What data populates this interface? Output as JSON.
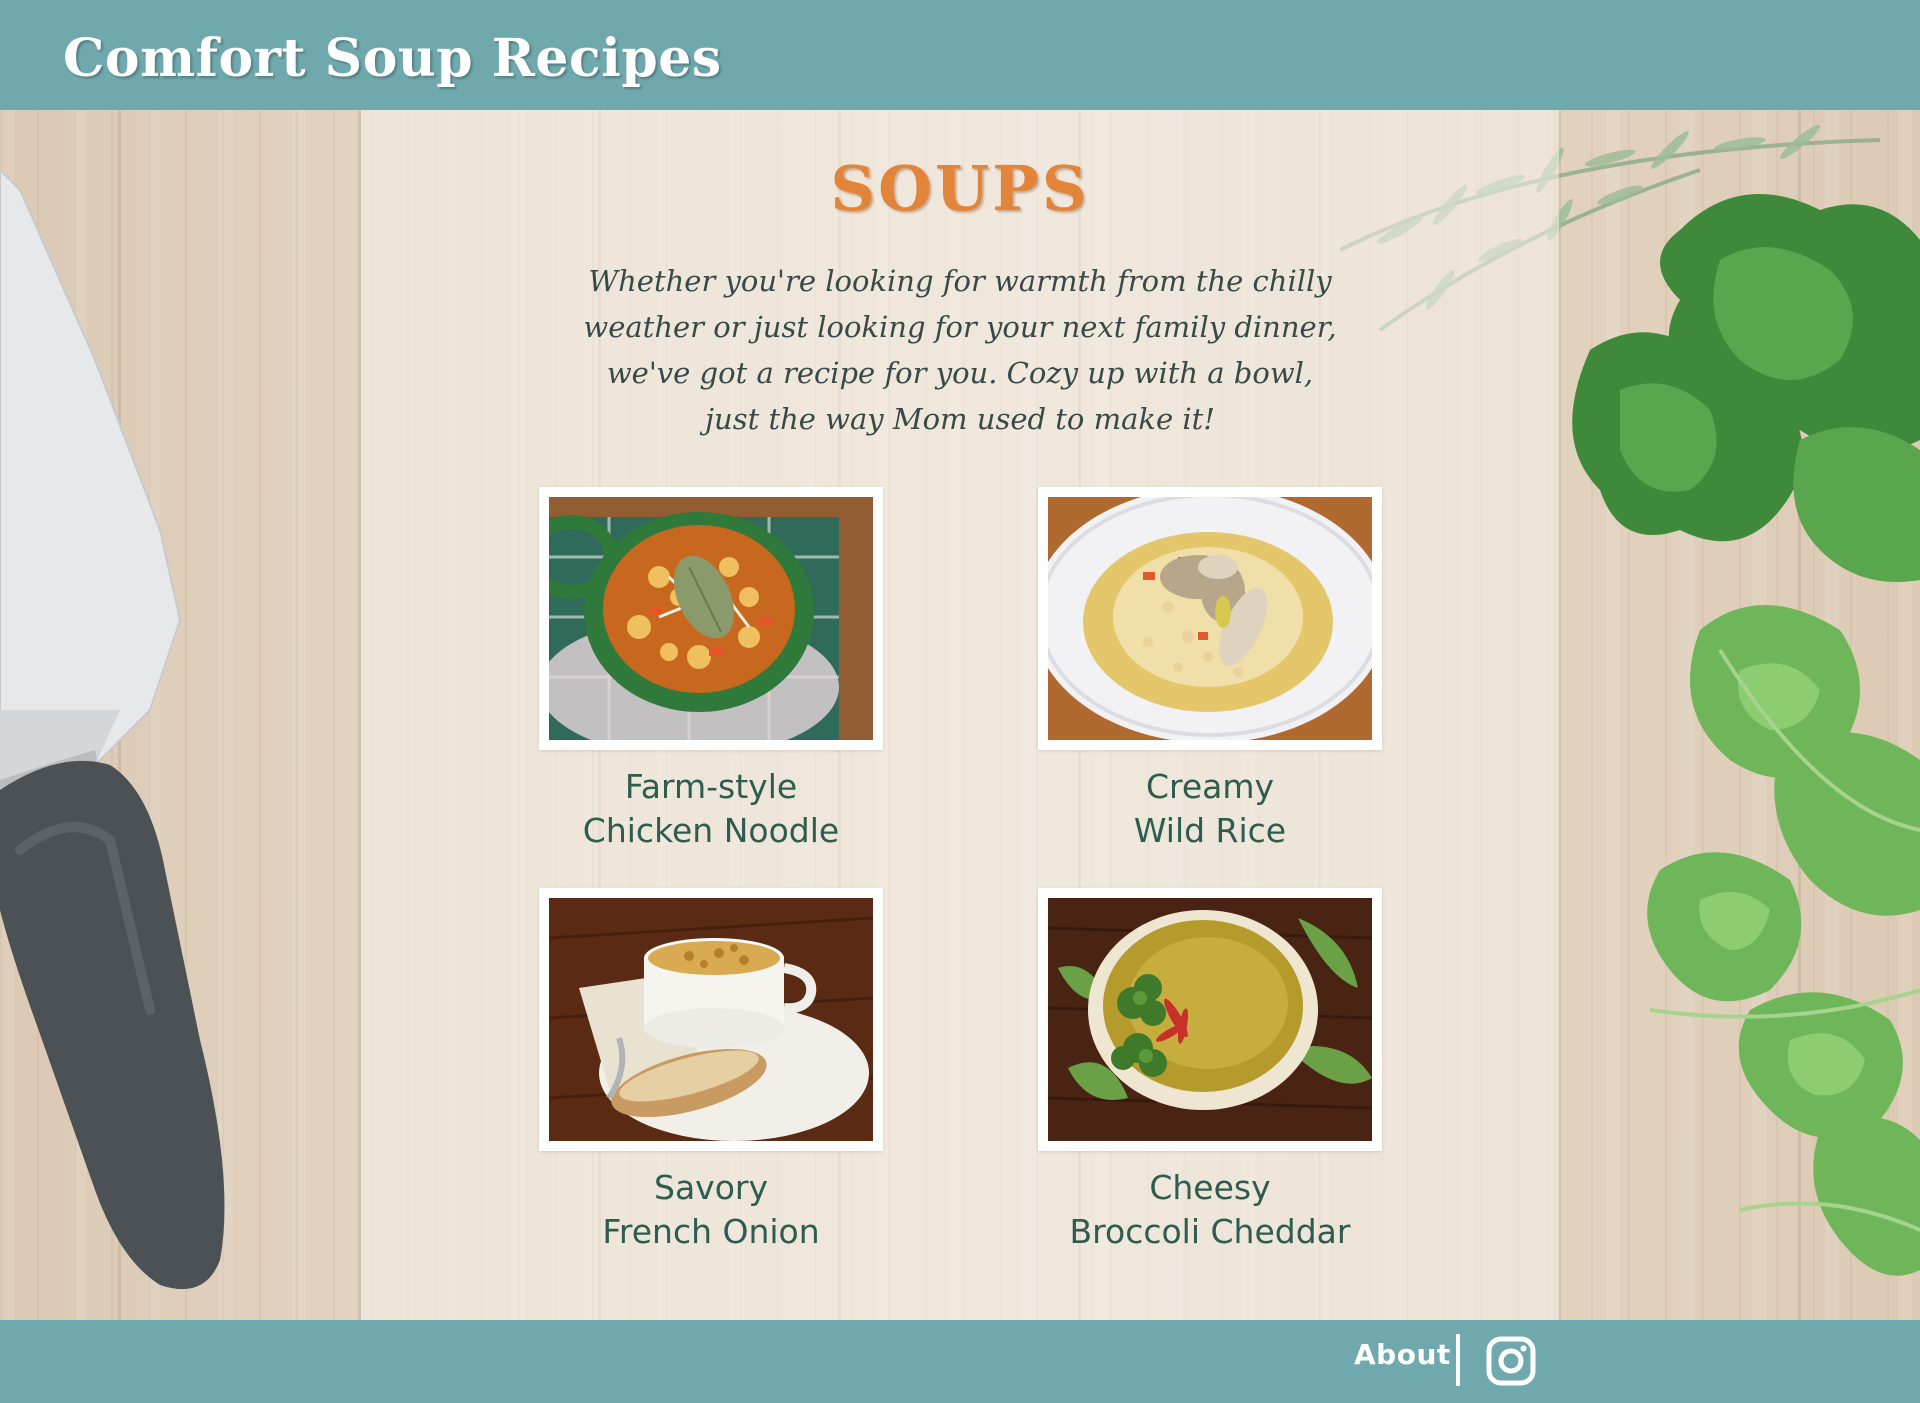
{
  "header": {
    "title": "Comfort Soup Recipes"
  },
  "main": {
    "heading": "SOUPS",
    "intro_lines": [
      "Whether you're looking for warmth from the chilly",
      "weather or just looking for your next family dinner,",
      "we've got a recipe for you. Cozy up with a bowl,",
      "just the way Mom used to make it!"
    ],
    "recipes": [
      {
        "line1": "Farm-style",
        "line2": "Chicken Noodle"
      },
      {
        "line1": "Creamy",
        "line2": "Wild Rice"
      },
      {
        "line1": "Savory",
        "line2": "French Onion"
      },
      {
        "line1": "Cheesy",
        "line2": "Broccoli Cheddar"
      }
    ]
  },
  "footer": {
    "about_label": "About",
    "social_icon": "instagram-icon"
  },
  "colors": {
    "bar": "#6fa9ad",
    "heading": "#e2853a",
    "caption": "#2e5d4f",
    "intro": "#384a48"
  }
}
